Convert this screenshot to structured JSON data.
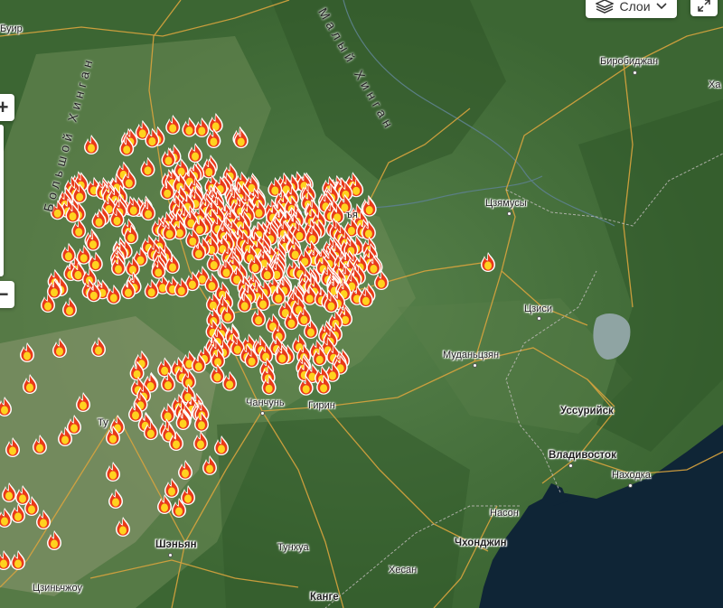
{
  "map": {
    "cities": [
      {
        "id": "buir",
        "label": "Буир",
        "bold": false
      },
      {
        "id": "birobidzhan",
        "label": "Биробиджан",
        "bold": false
      },
      {
        "id": "kha",
        "label": "Ха",
        "bold": false
      },
      {
        "id": "jiamusi",
        "label": "Цзямусы",
        "bold": false
      },
      {
        "id": "jixi",
        "label": "Цзиси",
        "bold": false
      },
      {
        "id": "mudanjiang",
        "label": "Муданьцзян",
        "bold": false
      },
      {
        "id": "girin",
        "label": "Гирин",
        "bold": false
      },
      {
        "id": "changchun",
        "label": "Чанчунь",
        "bold": false
      },
      {
        "id": "tunhua",
        "label": "Тунхуа",
        "bold": false
      },
      {
        "id": "shenyang",
        "label": "Шэньян",
        "bold": true
      },
      {
        "id": "ussuriysk",
        "label": "Уссурийск",
        "bold": true
      },
      {
        "id": "vladivostok",
        "label": "Владивосток",
        "bold": true
      },
      {
        "id": "nakhodka",
        "label": "Находка",
        "bold": false
      },
      {
        "id": "nason",
        "label": "Насон",
        "bold": false
      },
      {
        "id": "chongjin",
        "label": "Чхонджин",
        "bold": true
      },
      {
        "id": "hesan",
        "label": "Хесан",
        "bold": false
      },
      {
        "id": "kange",
        "label": "Канге",
        "bold": true
      },
      {
        "id": "jinzhou",
        "label": "Цзиньчжоу",
        "bold": false
      },
      {
        "id": "tu",
        "label": "Ту",
        "bold": false
      },
      {
        "id": "sya",
        "label": "ъя",
        "bold": false
      }
    ],
    "ranges": [
      {
        "id": "big-khingan",
        "label": "Большой Хинган"
      },
      {
        "id": "small-khingan",
        "label": "Малый Хинган"
      }
    ]
  },
  "controls": {
    "layers_label": "Слои",
    "zoom_in": "+",
    "zoom_out": "−"
  },
  "colors": {
    "fire_outer": "#e83a1a",
    "fire_inner": "#ffd21f",
    "water": "#0f2536",
    "roads": "#d9a43e"
  },
  "icons": [
    "layers-icon",
    "chevron-down-icon",
    "expand-icon",
    "fire-icon",
    "zoom-handle-icon"
  ]
}
